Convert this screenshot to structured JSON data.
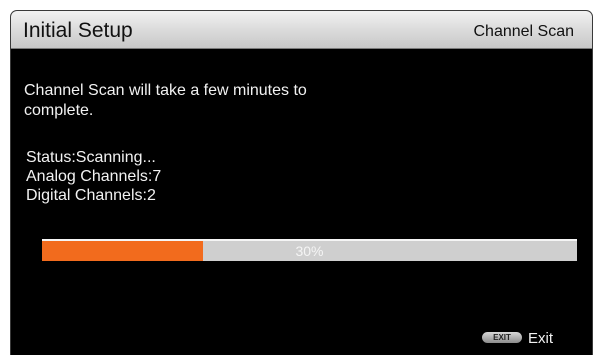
{
  "header": {
    "title": "Initial Setup",
    "section": "Channel Scan"
  },
  "message": "Channel Scan will take a few minutes to complete.",
  "status": {
    "status_text": "Status:Scanning...",
    "analog_text": "Analog Channels:7",
    "digital_text": "Digital Channels:2"
  },
  "progress": {
    "percent": 30,
    "label": "30%",
    "fill_color": "#f26b1d",
    "track_color": "#cfcfcf"
  },
  "footer": {
    "exit_key_label": "EXIT",
    "exit_label": "Exit"
  }
}
